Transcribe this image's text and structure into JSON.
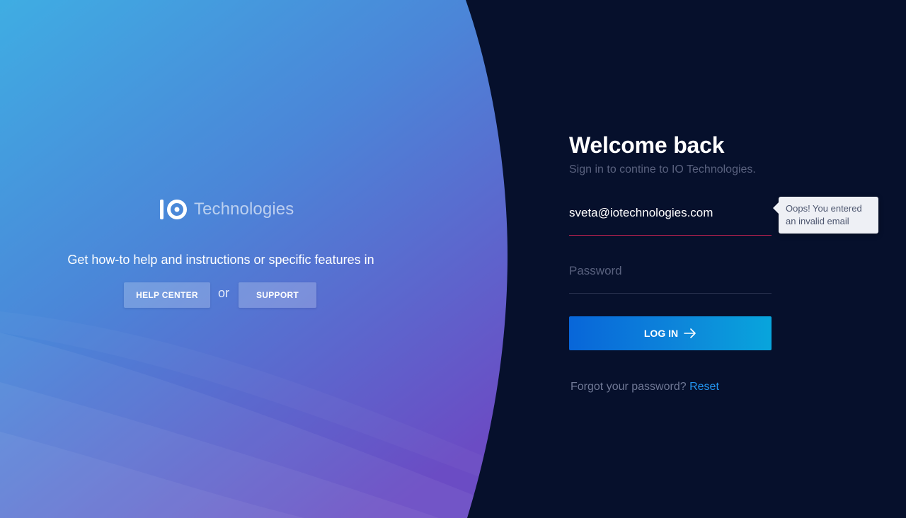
{
  "brand": {
    "name": "Technologies",
    "logo_icon": "io-logo-icon"
  },
  "help": {
    "text": "Get how-to help and instructions or specific features in",
    "help_center_label": "HELP CENTER",
    "or_label": "or",
    "support_label": "SUPPORT"
  },
  "login": {
    "title": "Welcome back",
    "subtitle": "Sign in to contine to IO Technologies.",
    "email_value": "sveta@iotechnologies.com",
    "password_placeholder": "Password",
    "error_tooltip_line1": "Oops! You entered",
    "error_tooltip_line2": "an invalid email",
    "login_button_label": "LOG IN",
    "login_button_icon": "arrow-right-icon",
    "forgot_text": "Forgot your password?",
    "reset_label": "Reset"
  },
  "colors": {
    "background": "#06102c",
    "gradient_start": "#3fa9e3",
    "gradient_end": "#6b4fc4",
    "error_underline": "#b8214f",
    "link": "#2395f0",
    "button_start": "#0866d9",
    "button_end": "#08a5dc"
  }
}
